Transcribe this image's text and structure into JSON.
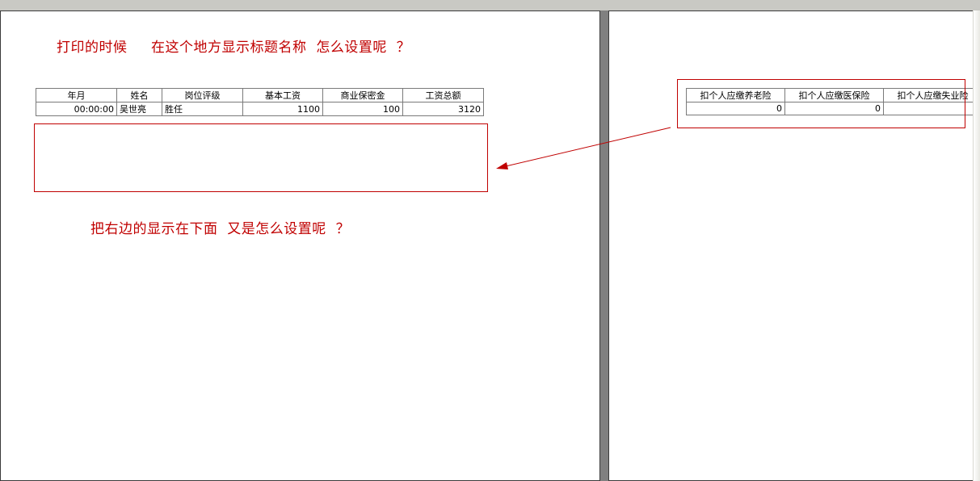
{
  "annotations": {
    "title_question": "打印的时候     在这个地方显示标题名称  怎么设置呢  ？",
    "move_question": "把右边的显示在下面  又是怎么设置呢  ？"
  },
  "left_table": {
    "headers": [
      "年月",
      "姓名",
      "岗位评级",
      "基本工资",
      "商业保密金",
      "工资总额"
    ],
    "row": [
      "00:00:00",
      "吴世亮",
      "胜任",
      "1100",
      "100",
      "3120"
    ]
  },
  "right_table": {
    "headers": [
      "扣个人应缴养老险",
      "扣个人应缴医保险",
      "扣个人应缴失业险"
    ],
    "row": [
      "0",
      "0",
      ""
    ]
  },
  "colors": {
    "annotation_red": "#c00000",
    "background_gray": "#808080"
  }
}
